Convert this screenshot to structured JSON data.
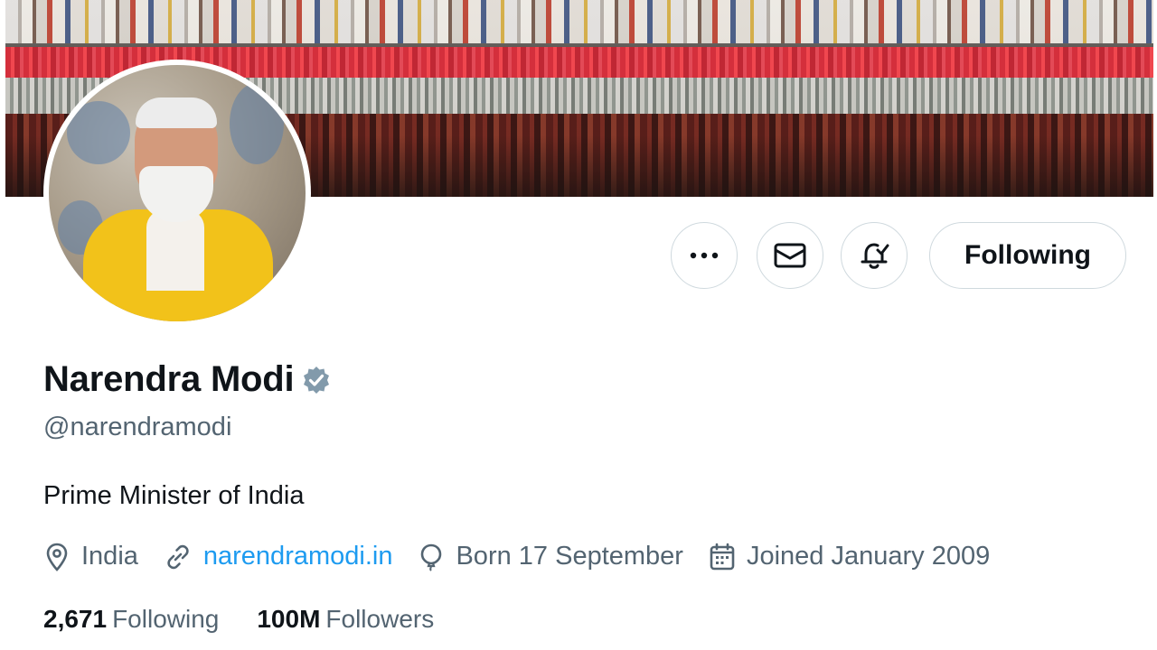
{
  "profile": {
    "name": "Narendra Modi",
    "handle": "@narendramodi",
    "bio": "Prime Minister of India",
    "verified_icon": "verified-badge-icon",
    "verified_color": "#829aab"
  },
  "actions": {
    "more_icon": "more-dots-icon",
    "message_icon": "envelope-icon",
    "notify_icon": "bell-plus-icon",
    "follow_label": "Following"
  },
  "meta": {
    "location": "India",
    "website": "narendramodi.in",
    "birthday": "Born 17 September",
    "joined": "Joined January 2009"
  },
  "stats": {
    "following_count": "2,671",
    "following_label": "Following",
    "followers_count": "100M",
    "followers_label": "Followers"
  },
  "colors": {
    "link": "#1d9bf0",
    "secondary_text": "#536471",
    "border": "#cfd9de"
  }
}
